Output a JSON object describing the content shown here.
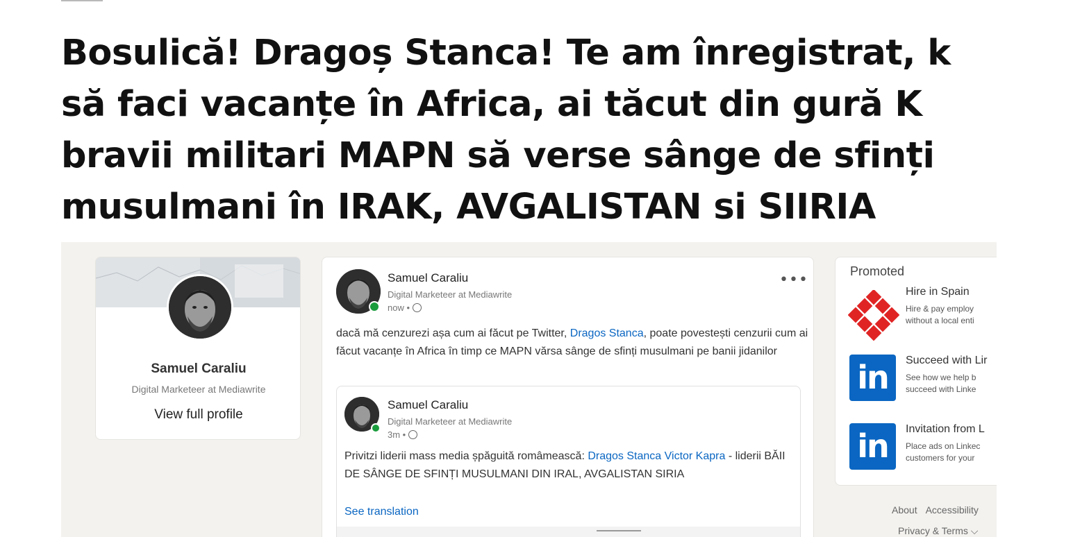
{
  "headline": "Bosulică! Dragoș Stanca! Te am înregistrat, k să faci vacanțe în Africa, ai tăcut din gură K bravii militari MAPN să verse sânge de sfinți musulmani în IRAK, AVGALISTAN si SIIRIA",
  "profile": {
    "name": "Samuel Caraliu",
    "title": "Digital Marketeer at Mediawrite",
    "view_profile": "View full profile"
  },
  "post": {
    "author": "Samuel Caraliu",
    "subtitle": "Digital Marketeer at Mediawrite",
    "time": "now •",
    "more": "•••",
    "text_before": "dacă mă cenzurezi așa cum ai făcut pe Twitter, ",
    "mention": "Dragos Stanca",
    "text_after": ", poate povestești cenzurii cum ai făcut vacanțe în Africa în timp ce MAPN vărsa sânge de sfinți musulmani pe banii jidanilor",
    "shared": {
      "author": "Samuel Caraliu",
      "subtitle": "Digital Marketeer at Mediawrite",
      "time": "3m •",
      "text_before": "Privitzi liderii mass media șpăguită româmească: ",
      "mention": "Dragos Stanca Victor Kapra",
      "text_after": " - liderii BĂII DE SÂNGE DE SFINȚI MUSULMANI DIN IRAL, AVGALISTAN SIRIA",
      "see_translation": "See translation"
    }
  },
  "promoted": {
    "label": "Promoted",
    "ads": [
      {
        "title": "Hire in Spain",
        "desc1": "Hire & pay employ",
        "desc2": "without a local enti",
        "logo": "hire-diamond-logo"
      },
      {
        "title": "Succeed with Lir",
        "desc1": "See how we help b",
        "desc2": "succeed with Linke",
        "logo": "in"
      },
      {
        "title": "Invitation from L",
        "desc1": "Place ads on Linkec",
        "desc2": "customers for your",
        "logo": "in"
      }
    ]
  },
  "footer": {
    "about": "About",
    "accessibility": "Accessibility",
    "privacy": "Privacy & Terms"
  },
  "colors": {
    "link": "#0a66c2",
    "linkedin_blue": "#0a66c2",
    "online": "#1a9c3d",
    "hire_red": "#e02424"
  }
}
